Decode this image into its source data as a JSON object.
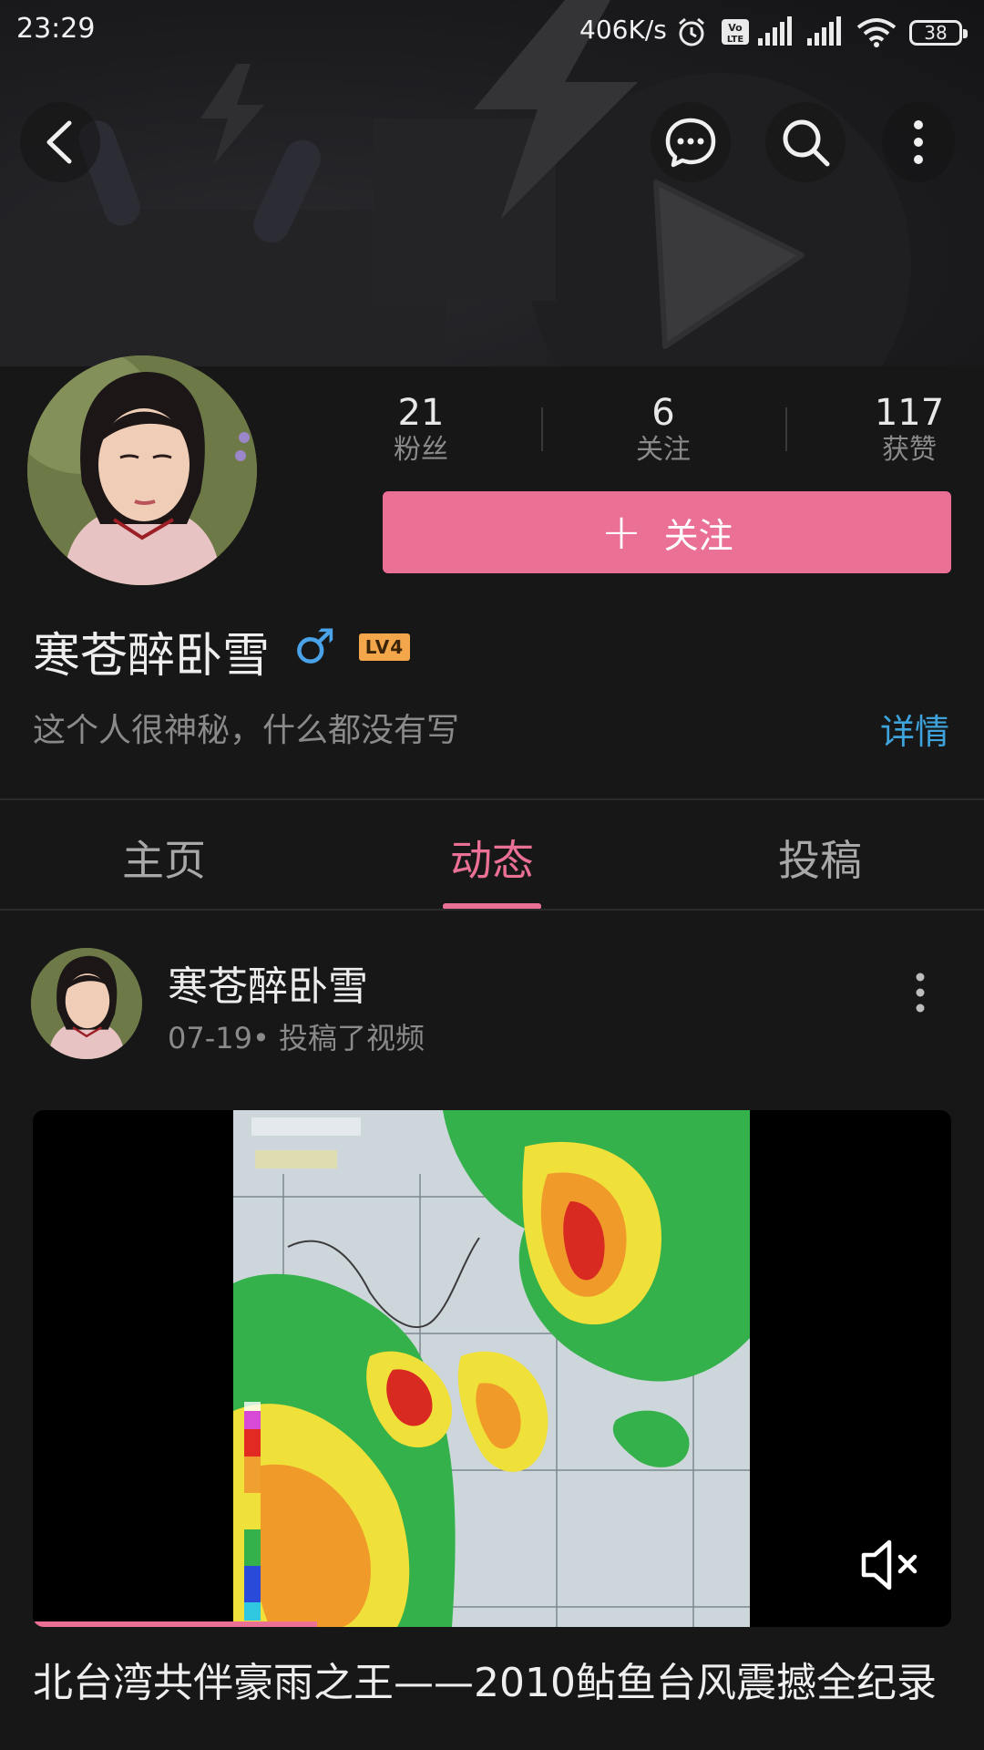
{
  "status_bar": {
    "time": "23:29",
    "network_speed": "406K/s",
    "battery": "38",
    "icons": [
      "alarm-icon",
      "volte-icon",
      "signal-icon",
      "signal-icon",
      "wifi-icon",
      "battery-icon"
    ]
  },
  "header": {
    "icons": [
      "back-icon",
      "message-icon",
      "search-icon",
      "more-vertical-icon"
    ]
  },
  "profile": {
    "stats": [
      {
        "value": "21",
        "label": "粉丝"
      },
      {
        "value": "6",
        "label": "关注"
      },
      {
        "value": "117",
        "label": "获赞"
      }
    ],
    "follow_button": "关注",
    "username": "寒苍醉卧雪",
    "gender_symbol": "♂",
    "level": "LV4",
    "bio": "这个人很神秘，什么都没有写",
    "details_link": "详情"
  },
  "tabs": [
    {
      "label": "主页",
      "active": false
    },
    {
      "label": "动态",
      "active": true
    },
    {
      "label": "投稿",
      "active": false
    }
  ],
  "post": {
    "author": "寒苍醉卧雪",
    "meta": "07-19• 投稿了视频",
    "video": {
      "progress_fraction": 0.31,
      "muted": true
    },
    "title": "北台湾共伴豪雨之王——2010鲇鱼台风震撼全纪录"
  },
  "colors": {
    "accent": "#ea7095",
    "link": "#3da3da",
    "background": "#171717"
  }
}
